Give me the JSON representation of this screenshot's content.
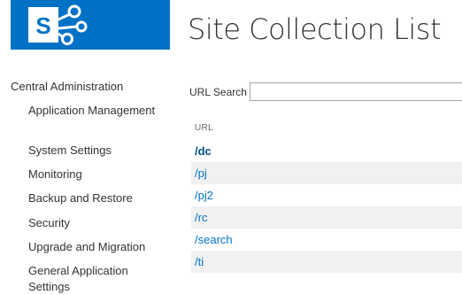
{
  "brand": {
    "accent_color": "#0072c6",
    "logo_icon": "sharepoint-logo-icon"
  },
  "page": {
    "title": "Site Collection List"
  },
  "nav": {
    "root_label": "Central Administration",
    "items": [
      {
        "label": "Application Management"
      },
      {
        "label": "System Settings"
      },
      {
        "label": "Monitoring"
      },
      {
        "label": "Backup and Restore"
      },
      {
        "label": "Security"
      },
      {
        "label": "Upgrade and Migration"
      },
      {
        "label": "General Application Settings"
      }
    ]
  },
  "search": {
    "label": "URL Search",
    "value": ""
  },
  "table": {
    "column_header": "URL",
    "rows": [
      {
        "url": "/dc",
        "selected": true
      },
      {
        "url": "/pj"
      },
      {
        "url": "/pj2"
      },
      {
        "url": "/rc"
      },
      {
        "url": "/search"
      },
      {
        "url": "/ti"
      }
    ]
  }
}
